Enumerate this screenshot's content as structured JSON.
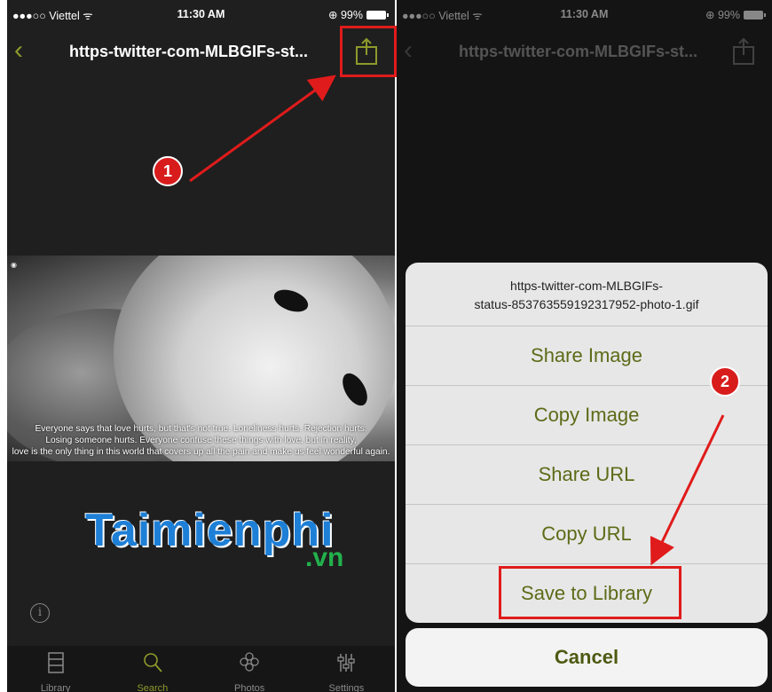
{
  "left": {
    "status": {
      "carrier": "●●●○○ Viettel ᯤ",
      "time": "11:30 AM",
      "battery": "⊕ 99%"
    },
    "title": "https-twitter-com-MLBGIFs-st...",
    "photo_quote": [
      "Everyone says that love hurts, but that's not true. Loneliness hurts. Rejection hurts.",
      "Losing someone hurts. Everyone confuse these things with love, but in reality,",
      "love is the only thing in this world that covers up all the pain and make us feel wonderful again."
    ],
    "logo_main": "Taimienphi",
    "logo_tld": ".vn",
    "tabs": [
      {
        "label": "Library",
        "icon": "library-icon"
      },
      {
        "label": "Search",
        "icon": "search-icon"
      },
      {
        "label": "Photos",
        "icon": "photos-icon"
      },
      {
        "label": "Settings",
        "icon": "settings-icon"
      }
    ],
    "step": "1"
  },
  "right": {
    "status": {
      "carrier": "●●●○○ Viettel ᯤ",
      "time": "11:30 AM",
      "battery": "⊕ 99%"
    },
    "title": "https-twitter-com-MLBGIFs-st...",
    "sheet_header": [
      "https-twitter-com-MLBGIFs-",
      "status-853763559192317952-photo-1.gif"
    ],
    "actions": [
      "Share Image",
      "Copy Image",
      "Share URL",
      "Copy URL",
      "Save to Library"
    ],
    "cancel": "Cancel",
    "step": "2"
  },
  "colors": {
    "accent": "#8e9a2b",
    "annotation": "#e01b1b",
    "action_text": "#5c6b17"
  }
}
